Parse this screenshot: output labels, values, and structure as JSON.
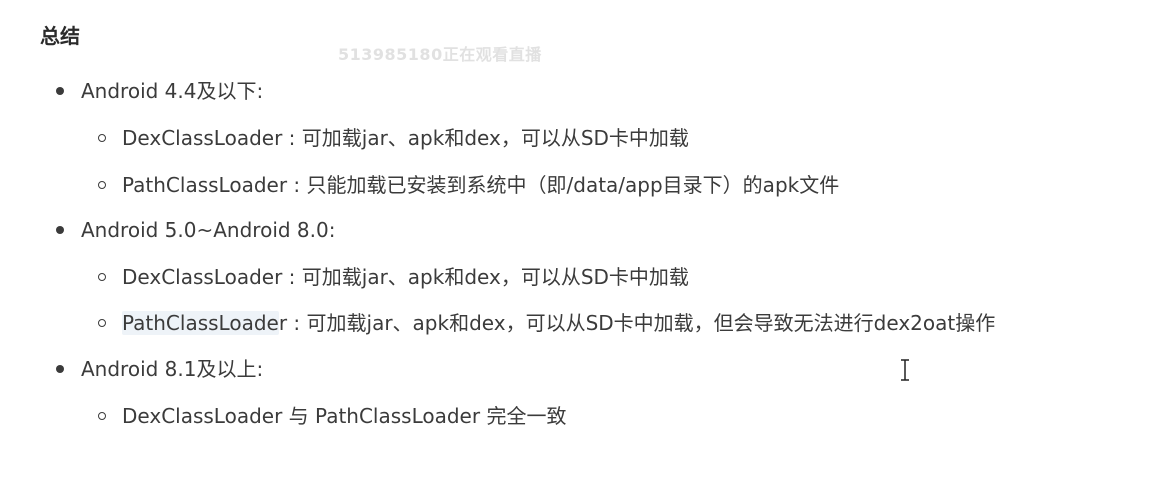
{
  "heading": "总结",
  "watermark": "513985180正在观看直播",
  "sections": [
    {
      "title": "Android 4.4及以下:",
      "items": [
        "DexClassLoader : 可加载jar、apk和dex，可以从SD卡中加载",
        "PathClassLoader : 只能加载已安装到系统中（即/data/app目录下）的apk文件"
      ]
    },
    {
      "title": "Android 5.0~Android 8.0:",
      "items": [
        "DexClassLoader : 可加载jar、apk和dex，可以从SD卡中加载",
        {
          "highlight": "PathClassLoade",
          "rest": "r : 可加载jar、apk和dex，可以从SD卡中加载，但会导致无法进行dex2oat操作"
        }
      ]
    },
    {
      "title": "Android 8.1及以上:",
      "items": [
        "DexClassLoader 与 PathClassLoader 完全一致"
      ]
    }
  ],
  "cursor": "text-cursor-icon"
}
